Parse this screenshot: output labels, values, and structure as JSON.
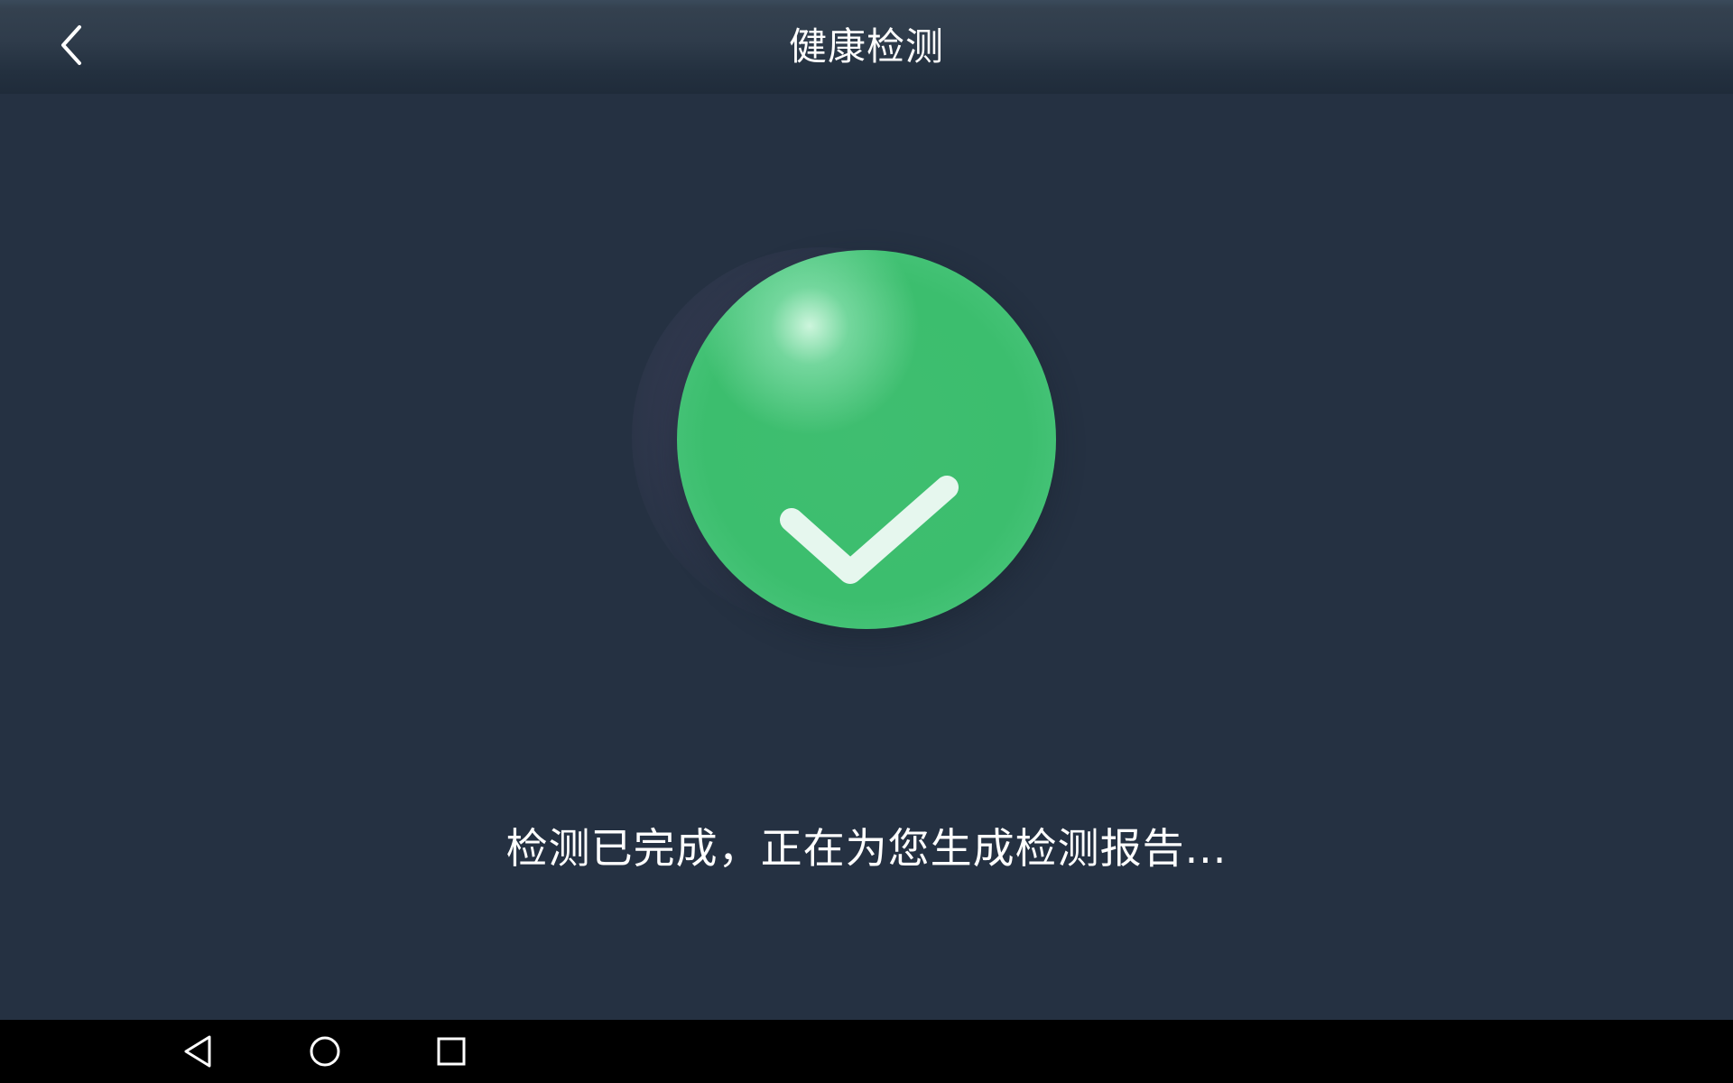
{
  "header": {
    "title": "健康检测",
    "back_icon": "chevron-left-icon"
  },
  "main": {
    "status_icon": "check-circle-icon",
    "status_color": "#3cbe6e",
    "status_text": "检测已完成，正在为您生成检测报告..."
  },
  "system_nav": {
    "back_icon": "triangle-back-icon",
    "home_icon": "circle-home-icon",
    "recents_icon": "square-recents-icon"
  },
  "colors": {
    "background": "#253142",
    "header": "#2f3c4b",
    "navbar": "#000000",
    "text": "#ffffff"
  }
}
